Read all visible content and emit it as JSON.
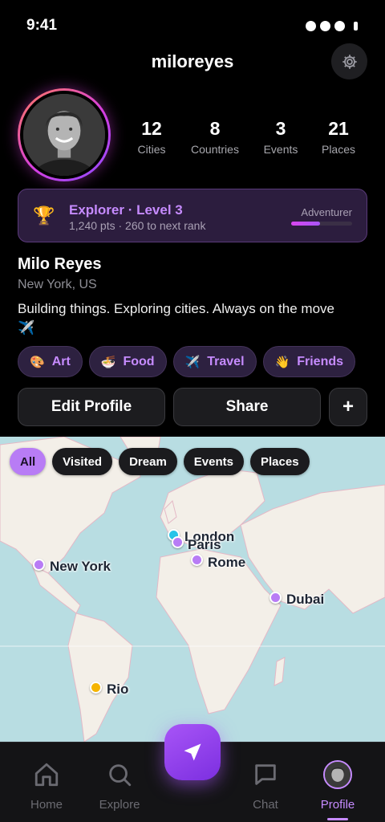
{
  "status_bar": {
    "time": "9:41"
  },
  "header": {
    "username": "miloreyes"
  },
  "stats": [
    {
      "value": "12",
      "label": "Cities"
    },
    {
      "value": "8",
      "label": "Countries"
    },
    {
      "value": "3",
      "label": "Events"
    },
    {
      "value": "21",
      "label": "Places"
    }
  ],
  "rank": {
    "title": "Explorer · Level 3",
    "subtitle": "1,240 pts · 260 to next rank",
    "next_rank": "Adventurer",
    "progress": 0.48,
    "accent": "#c68bff"
  },
  "profile": {
    "name": "Milo Reyes",
    "location": "New York, US",
    "bio": "Building things. Exploring cities. Always on the move ✈️"
  },
  "interests": [
    {
      "emoji": "🎨",
      "label": "Art"
    },
    {
      "emoji": "🍜",
      "label": "Food"
    },
    {
      "emoji": "✈️",
      "label": "Travel"
    },
    {
      "emoji": "👋",
      "label": "Friends"
    }
  ],
  "actions": {
    "edit": "Edit Profile",
    "share": "Share",
    "more": "+"
  },
  "map": {
    "filters": [
      "All",
      "Visited",
      "Dream",
      "Events",
      "Places"
    ],
    "active_filter": "All",
    "pins": [
      {
        "label": "London",
        "color": "#27c3e8"
      },
      {
        "label": "Paris",
        "color": "#b87cf5"
      },
      {
        "label": "Rome",
        "color": "#b87cf5"
      },
      {
        "label": "New York",
        "color": "#b87cf5"
      },
      {
        "label": "Dubai",
        "color": "#b87cf5"
      },
      {
        "label": "Rio",
        "color": "#f5b400"
      }
    ]
  },
  "tabbar": {
    "items": [
      {
        "label": "Home",
        "icon": "home-icon"
      },
      {
        "label": "Explore",
        "icon": "search-icon"
      },
      {
        "label": "Chat",
        "icon": "chat-icon"
      },
      {
        "label": "Profile",
        "icon": "avatar"
      }
    ],
    "active": "Profile",
    "fab_icon": "navigation-arrow-icon"
  }
}
